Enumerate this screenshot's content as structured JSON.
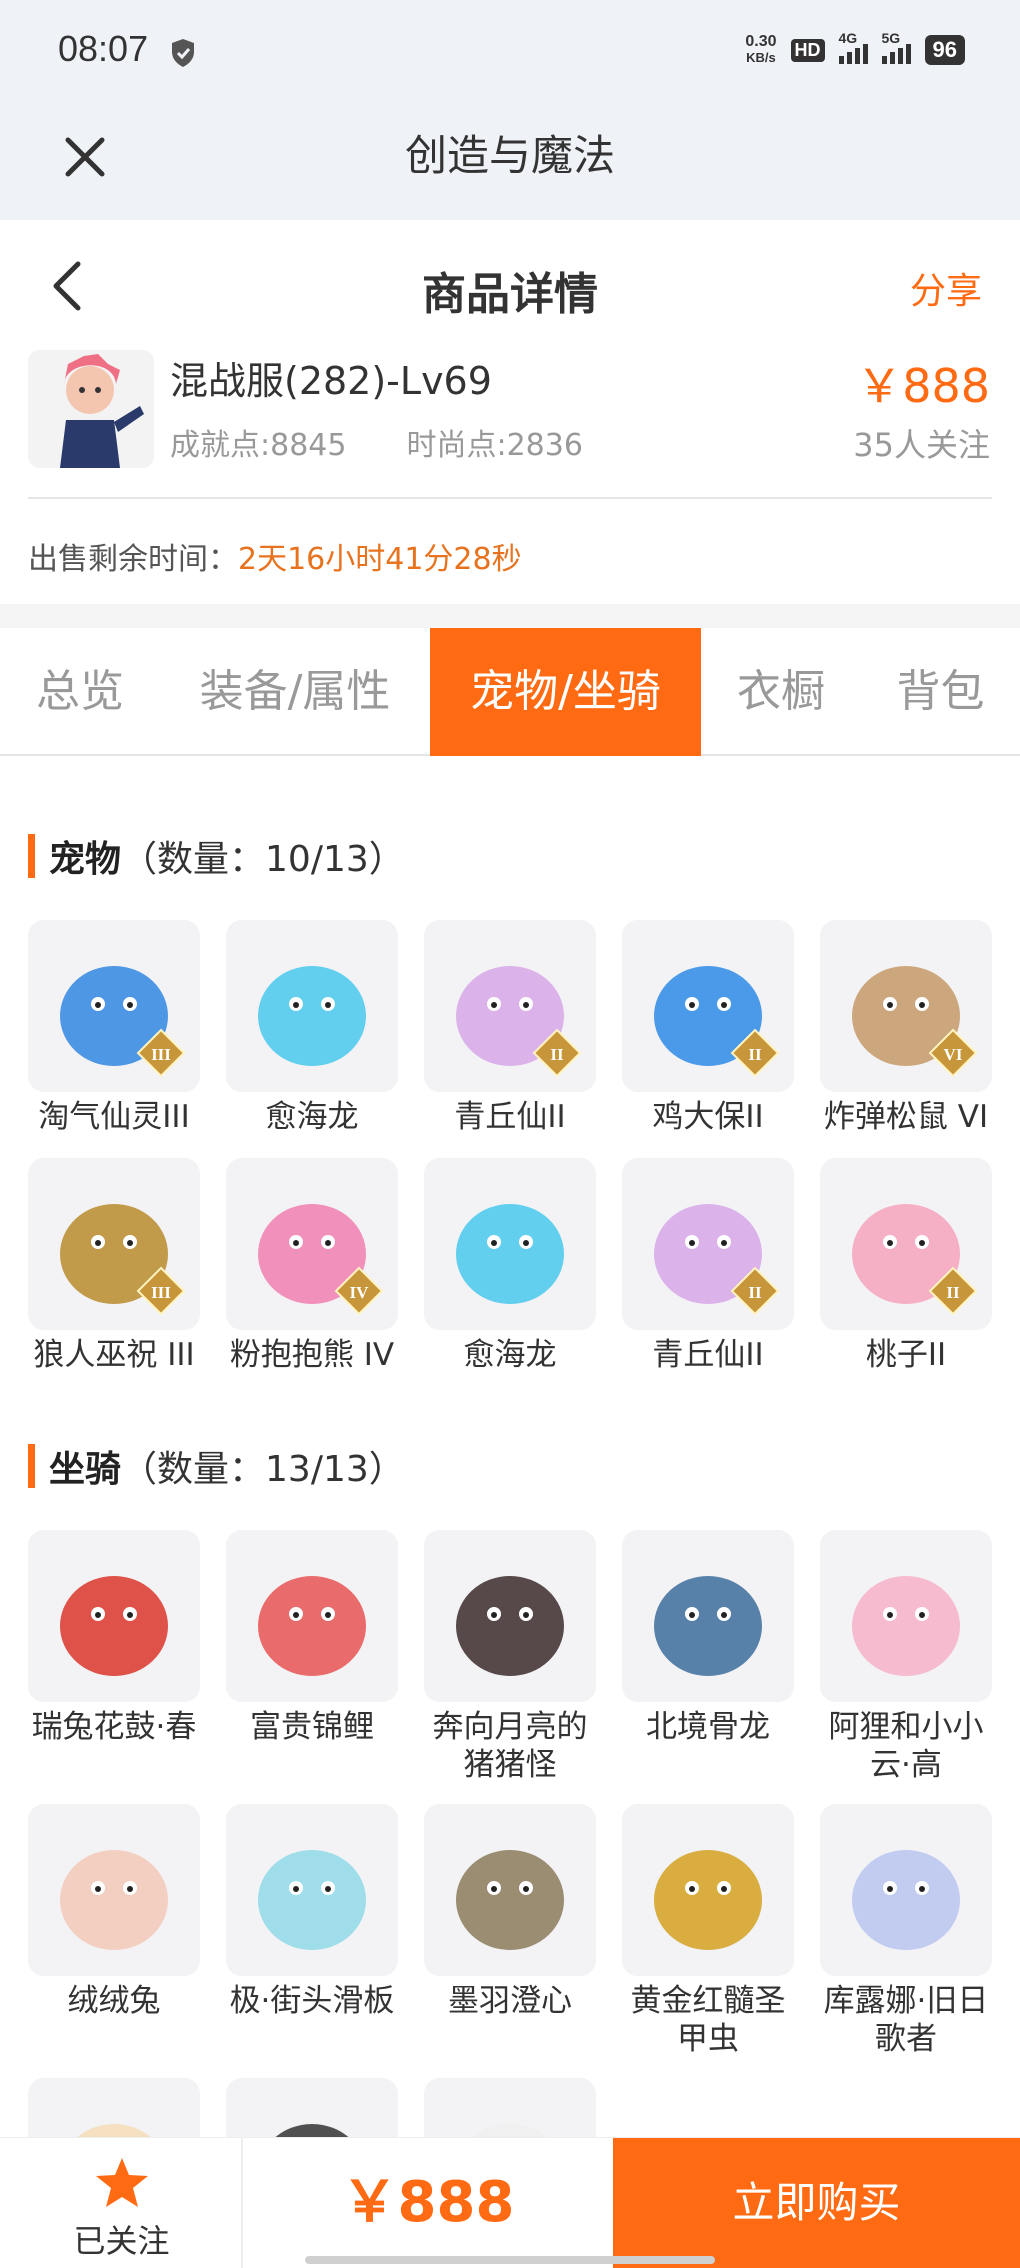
{
  "status": {
    "time": "08:07",
    "net_speed": "0.30",
    "net_unit": "KB/s",
    "hd": "HD",
    "sim1": "4G",
    "sim2": "5G",
    "battery": "96"
  },
  "app": {
    "title": "创造与魔法"
  },
  "nav": {
    "title": "商品详情",
    "share": "分享"
  },
  "product": {
    "name": "混战服(282)-Lv69",
    "achievement": "成就点:8845",
    "fashion": "时尚点:2836",
    "price": "￥888",
    "followers": "35人关注",
    "timer_label": "出售剩余时间：",
    "timer_value": "2天16小时41分28秒"
  },
  "tabs": [
    "总览",
    "装备/属性",
    "宠物/坐骑",
    "衣橱",
    "背包"
  ],
  "pets": {
    "label": "宠物",
    "count": "（数量：10/13）",
    "items": [
      {
        "name": "淘气仙灵III",
        "badge": "III",
        "color": "#2f86e0",
        "icon": "blue-puppy"
      },
      {
        "name": "愈海龙",
        "badge": "",
        "color": "#48c8ec",
        "icon": "sea-dragon"
      },
      {
        "name": "青丘仙II",
        "badge": "II",
        "color": "#d6a6e6",
        "icon": "fox-fairy"
      },
      {
        "name": "鸡大保II",
        "badge": "II",
        "color": "#2d8ae6",
        "icon": "cool-bird"
      },
      {
        "name": "炸弹松鼠 VI",
        "badge": "VI",
        "color": "#c49866",
        "icon": "squirrel"
      },
      {
        "name": "狼人巫祝 III",
        "badge": "III",
        "color": "#b78a2c",
        "icon": "werewolf-shaman"
      },
      {
        "name": "粉抱抱熊 IV",
        "badge": "IV",
        "color": "#f07fb0",
        "icon": "pink-bear"
      },
      {
        "name": "愈海龙",
        "badge": "",
        "color": "#48c8ec",
        "icon": "sea-dragon"
      },
      {
        "name": "青丘仙II",
        "badge": "II",
        "color": "#d6a6e6",
        "icon": "fox-fairy"
      },
      {
        "name": "桃子II",
        "badge": "II",
        "color": "#f4a3bd",
        "icon": "peach-cat"
      }
    ]
  },
  "mounts": {
    "label": "坐骑",
    "count": "（数量：13/13）",
    "items": [
      {
        "name": "瑞兔花鼓·春",
        "color": "#d9352a",
        "icon": "drum"
      },
      {
        "name": "富贵锦鲤",
        "color": "#e85252",
        "icon": "koi"
      },
      {
        "name": "奔向月亮的猪猪怪",
        "color": "#3b2a2a",
        "icon": "pig"
      },
      {
        "name": "北境骨龙",
        "color": "#3c6c9c",
        "icon": "bone-dragon"
      },
      {
        "name": "阿狸和小小云·高",
        "color": "#f6b0c8",
        "icon": "cloud-fox"
      },
      {
        "name": "绒绒兔",
        "color": "#f2c8b8",
        "icon": "fluffy-rabbit"
      },
      {
        "name": "极·街头滑板",
        "color": "#8ed8e6",
        "icon": "skateboard"
      },
      {
        "name": "墨羽澄心",
        "color": "#8a7a5a",
        "icon": "feather-sword"
      },
      {
        "name": "黄金红髓圣甲虫",
        "color": "#d4a020",
        "icon": "scarab"
      },
      {
        "name": "库露娜·旧日歌者",
        "color": "#b8c4f0",
        "icon": "singer"
      },
      {
        "name": "",
        "color": "#f4dcb8",
        "icon": "fox-partial"
      },
      {
        "name": "",
        "color": "#333333",
        "icon": "dark-partial"
      },
      {
        "name": "",
        "color": "#eeeeee",
        "icon": "panda-partial"
      }
    ]
  },
  "bottom": {
    "follow_label": "已关注",
    "total": "￥888",
    "buy": "立即购买"
  },
  "colors": {
    "accent": "#ff6a13",
    "timer": "#e8731f"
  }
}
